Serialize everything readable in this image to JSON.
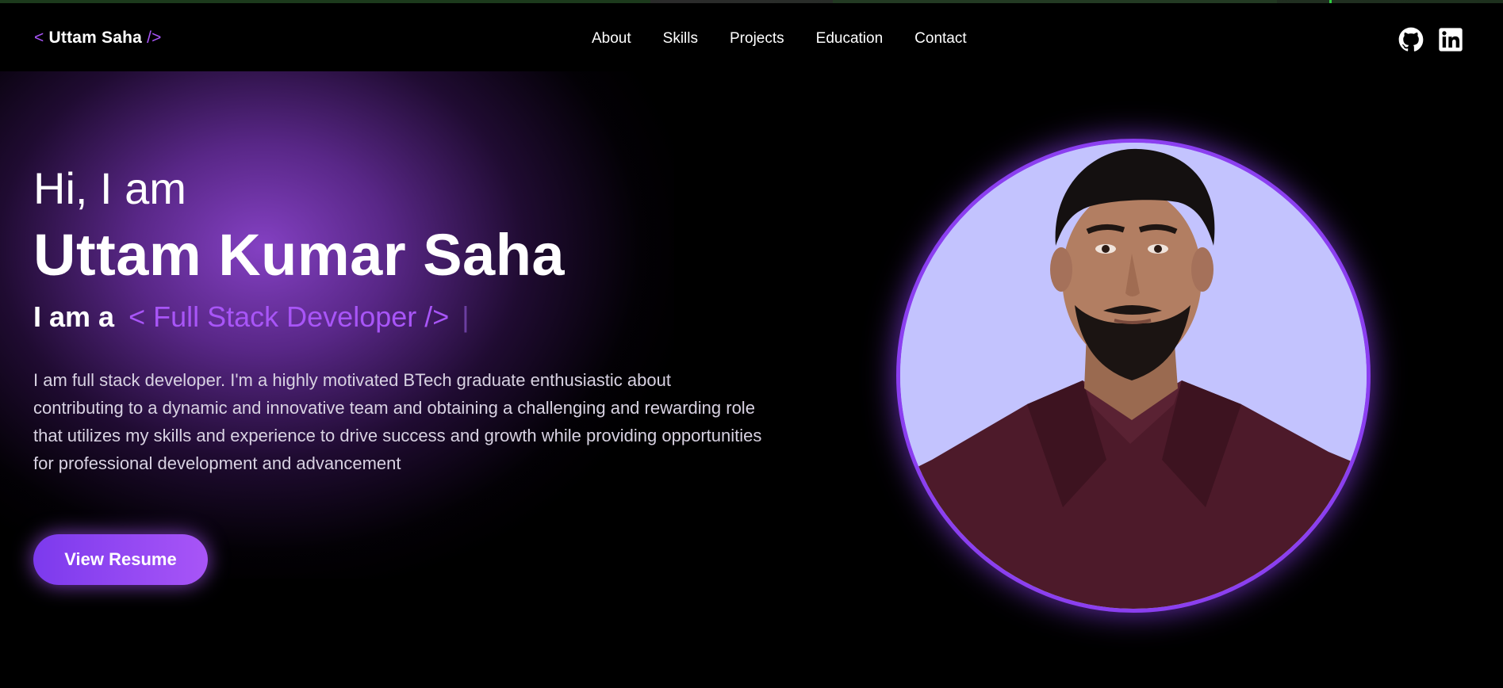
{
  "brand": {
    "open": "<",
    "name": "Uttam Saha",
    "close": "/>"
  },
  "nav": {
    "links": [
      {
        "label": "About"
      },
      {
        "label": "Skills"
      },
      {
        "label": "Projects"
      },
      {
        "label": "Education"
      },
      {
        "label": "Contact"
      }
    ]
  },
  "social": {
    "icons": [
      "github-icon",
      "linkedin-icon"
    ]
  },
  "hero": {
    "greeting": "Hi, I am",
    "name": "Uttam Kumar Saha",
    "role_prefix": "I am a",
    "role_text": "< Full Stack Developer />",
    "caret": "|",
    "description": "I am full stack developer. I'm a highly motivated BTech graduate enthusiastic about contributing to a dynamic and innovative team and obtaining a challenging and rewarding role that utilizes my skills and experience to drive success and growth while providing opportunities for professional development and advancement",
    "resume_button": "View Resume"
  },
  "colors": {
    "accent": "#a855f7",
    "accent_dark": "#7c3aed",
    "background": "#000000",
    "photo_bg": "#c4c4ff"
  }
}
